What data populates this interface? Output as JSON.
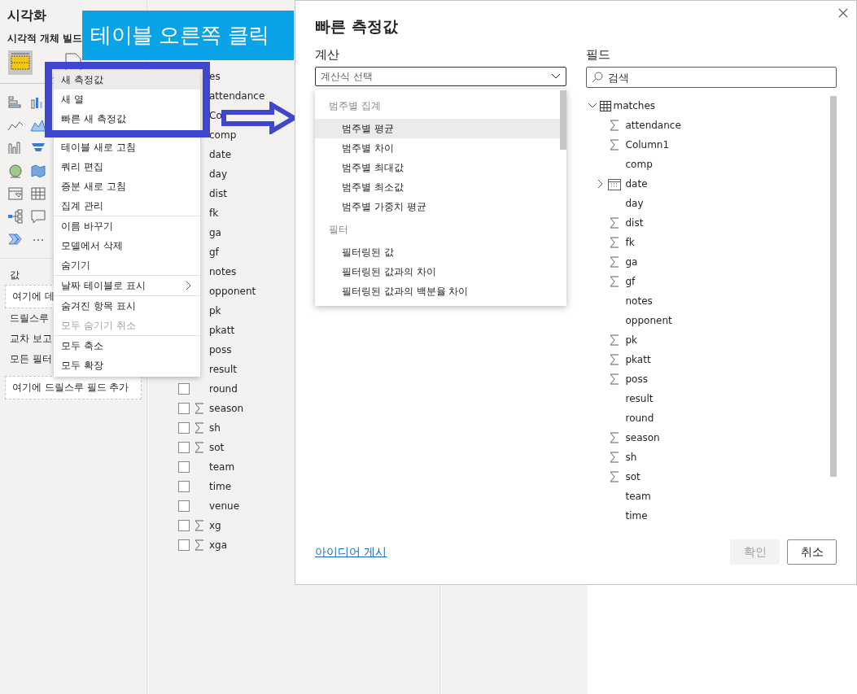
{
  "visualizations_pane": {
    "title": "시각화",
    "subtitle": "시각적 개체 빌드",
    "values_label": "값",
    "values_well": "여기에 데",
    "drillthrough_label": "드릴스루",
    "cross_report_label": "교차 보고",
    "all_filters_label": "모든 필터",
    "drillthrough_well": "여기에 드릴스루 필드 추가"
  },
  "fields_pane": {
    "items": [
      {
        "name": "es",
        "kind": "table"
      },
      {
        "name": "attendance",
        "kind": "hidden"
      },
      {
        "name": "Co",
        "kind": "hidden"
      },
      {
        "name": "comp",
        "kind": "hidden"
      },
      {
        "name": "date",
        "kind": "hidden"
      },
      {
        "name": "day",
        "kind": "hidden"
      },
      {
        "name": "dist",
        "kind": "hidden"
      },
      {
        "name": "fk",
        "kind": "hidden"
      },
      {
        "name": "ga",
        "kind": "hidden"
      },
      {
        "name": "gf",
        "kind": "hidden"
      },
      {
        "name": "notes",
        "kind": "hidden"
      },
      {
        "name": "opponent",
        "kind": "hidden"
      },
      {
        "name": "pk",
        "kind": "hidden"
      },
      {
        "name": "pkatt",
        "kind": "hidden"
      },
      {
        "name": "poss",
        "kind": "hidden"
      },
      {
        "name": "result",
        "kind": "partial"
      },
      {
        "name": "round",
        "kind": "text",
        "checked": false
      },
      {
        "name": "season",
        "kind": "sum",
        "checked": false
      },
      {
        "name": "sh",
        "kind": "sum",
        "checked": false
      },
      {
        "name": "sot",
        "kind": "sum",
        "checked": false
      },
      {
        "name": "team",
        "kind": "text",
        "checked": false
      },
      {
        "name": "time",
        "kind": "text",
        "checked": false
      },
      {
        "name": "venue",
        "kind": "text",
        "checked": false
      },
      {
        "name": "xg",
        "kind": "sum",
        "checked": false
      },
      {
        "name": "xga",
        "kind": "sum",
        "checked": false
      }
    ]
  },
  "context_menu": {
    "groups": [
      [
        {
          "label": "새 측정값",
          "kind": "command",
          "highlighted": true,
          "disabled": false
        },
        {
          "label": "새 열",
          "kind": "command",
          "highlighted": false,
          "disabled": false
        },
        {
          "label": "빠른 새 측정값",
          "kind": "command",
          "highlighted": false,
          "disabled": false
        },
        {
          "label": "테이블 새로 고침",
          "kind": "command",
          "highlighted": false,
          "disabled": false
        },
        {
          "label": "쿼리 편집",
          "kind": "command",
          "highlighted": false,
          "disabled": false
        },
        {
          "label": "증분 새로 고침",
          "kind": "command",
          "highlighted": false,
          "disabled": false
        },
        {
          "label": "집계 관리",
          "kind": "command",
          "highlighted": false,
          "disabled": false
        }
      ],
      [
        {
          "label": "이름 바꾸기",
          "kind": "command",
          "highlighted": false,
          "disabled": false
        },
        {
          "label": "모델에서 삭제",
          "kind": "command",
          "highlighted": false,
          "disabled": false
        },
        {
          "label": "숨기기",
          "kind": "command",
          "highlighted": false,
          "disabled": false
        }
      ],
      [
        {
          "label": "날짜 테이블로 표시",
          "kind": "submenu",
          "highlighted": false,
          "disabled": false
        }
      ],
      [
        {
          "label": "숨겨진 항목 표시",
          "kind": "command",
          "highlighted": false,
          "disabled": false
        },
        {
          "label": "모두 숨기기 취소",
          "kind": "command",
          "highlighted": false,
          "disabled": true
        }
      ],
      [
        {
          "label": "모두 축소",
          "kind": "command",
          "highlighted": false,
          "disabled": false
        },
        {
          "label": "모두 확장",
          "kind": "command",
          "highlighted": false,
          "disabled": false
        }
      ]
    ]
  },
  "annotation": {
    "banner": "테이블 오른쪽 클릭"
  },
  "dialog": {
    "title": "빠른 측정값",
    "calculation_label": "계산",
    "calculation_select": {
      "placeholder": "계산식 선택"
    },
    "calculation_options": [
      {
        "kind": "header",
        "label": "범주별 집계"
      },
      {
        "kind": "option",
        "label": "범주별 평균",
        "highlighted": true
      },
      {
        "kind": "option",
        "label": "범주별 차이",
        "highlighted": false
      },
      {
        "kind": "option",
        "label": "범주별 최대값",
        "highlighted": false
      },
      {
        "kind": "option",
        "label": "범주별 최소값",
        "highlighted": false
      },
      {
        "kind": "option",
        "label": "범주별 가중치 평균",
        "highlighted": false
      },
      {
        "kind": "header",
        "label": "필터"
      },
      {
        "kind": "option",
        "label": "필터링된 값",
        "highlighted": false
      },
      {
        "kind": "option",
        "label": "필터링된 값과의 차이",
        "highlighted": false
      },
      {
        "kind": "option",
        "label": "필터링된 값과의 백분율 차이",
        "highlighted": false
      }
    ],
    "fields_label": "필드",
    "search": {
      "placeholder": "검색"
    },
    "field_tree": {
      "name": "matches",
      "expanded": true,
      "children": [
        {
          "name": "attendance",
          "kind": "sum"
        },
        {
          "name": "Column1",
          "kind": "sum"
        },
        {
          "name": "comp",
          "kind": "text"
        },
        {
          "name": "date",
          "kind": "date",
          "expanded": false
        },
        {
          "name": "day",
          "kind": "text"
        },
        {
          "name": "dist",
          "kind": "sum"
        },
        {
          "name": "fk",
          "kind": "sum"
        },
        {
          "name": "ga",
          "kind": "sum"
        },
        {
          "name": "gf",
          "kind": "sum"
        },
        {
          "name": "notes",
          "kind": "text"
        },
        {
          "name": "opponent",
          "kind": "text"
        },
        {
          "name": "pk",
          "kind": "sum"
        },
        {
          "name": "pkatt",
          "kind": "sum"
        },
        {
          "name": "poss",
          "kind": "sum"
        },
        {
          "name": "result",
          "kind": "text"
        },
        {
          "name": "round",
          "kind": "text"
        },
        {
          "name": "season",
          "kind": "sum"
        },
        {
          "name": "sh",
          "kind": "sum"
        },
        {
          "name": "sot",
          "kind": "sum"
        },
        {
          "name": "team",
          "kind": "text"
        },
        {
          "name": "time",
          "kind": "text"
        }
      ]
    },
    "link": "아이디어 게시",
    "buttons": [
      {
        "label": "확인",
        "disabled": true
      },
      {
        "label": "취소",
        "disabled": false
      }
    ]
  }
}
